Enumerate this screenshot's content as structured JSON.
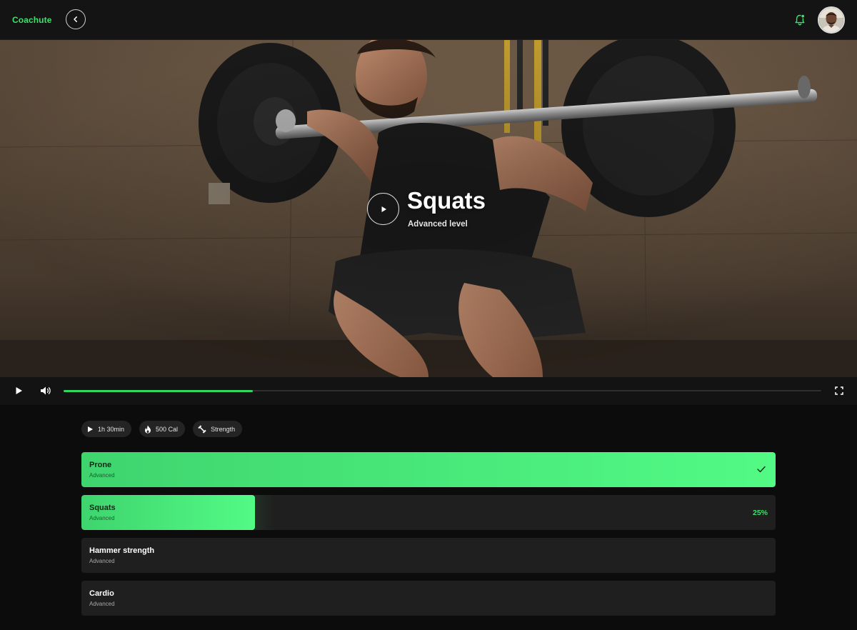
{
  "app": {
    "brand": "Coachute"
  },
  "header": {
    "notification_dot_color": "#3ee06b"
  },
  "hero": {
    "title": "Squats",
    "subtitle": "Advanced level"
  },
  "player": {
    "progress_fraction": 0.25,
    "accent": "#33d561"
  },
  "stats": [
    {
      "icon": "play-icon",
      "label": "1h 30min"
    },
    {
      "icon": "flame-icon",
      "label": "500 Cal"
    },
    {
      "icon": "dumbbell-icon",
      "label": "Strength"
    }
  ],
  "workouts": [
    {
      "name": "Prone",
      "level": "Advanced",
      "status": "completed",
      "progress": 1.0
    },
    {
      "name": "Squats",
      "level": "Advanced",
      "status": "in-progress",
      "progress": 0.25,
      "progress_label": "25%"
    },
    {
      "name": "Hammer strength",
      "level": "Advanced",
      "status": "pending",
      "progress": 0
    },
    {
      "name": "Cardio",
      "level": "Advanced",
      "status": "pending",
      "progress": 0
    }
  ]
}
